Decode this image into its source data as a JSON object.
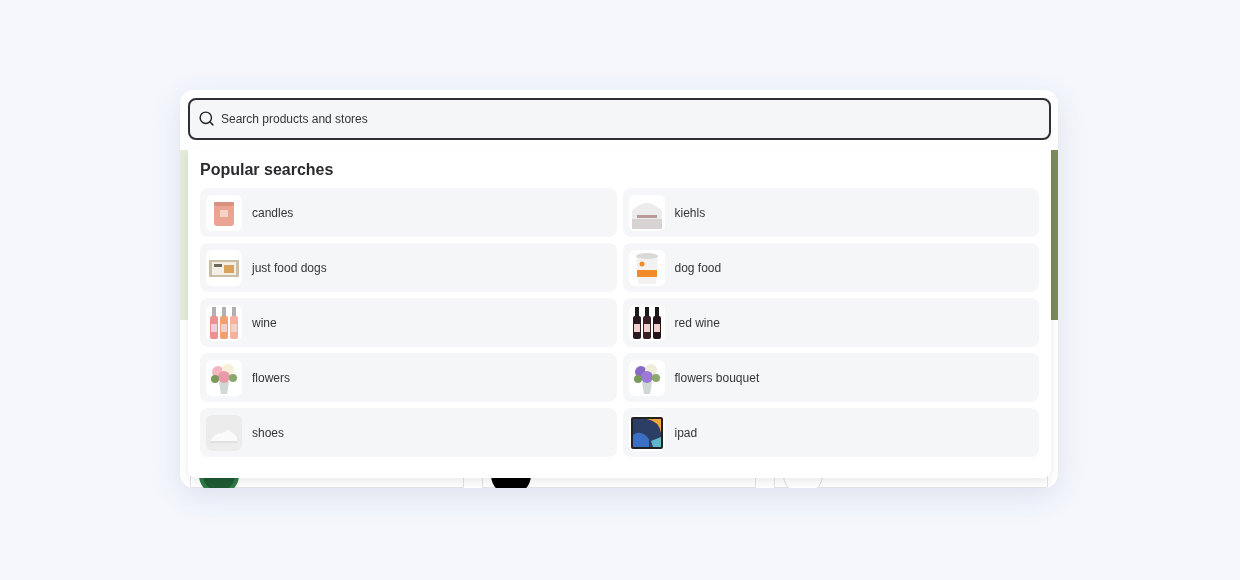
{
  "search": {
    "placeholder": "Search products and stores"
  },
  "popular": {
    "title": "Popular searches",
    "items": [
      {
        "label": "candles",
        "kind": "picture"
      },
      {
        "label": "kiehls",
        "kind": "picture"
      },
      {
        "label": "just food dogs",
        "kind": "picture"
      },
      {
        "label": "dog food",
        "kind": "picture"
      },
      {
        "label": "wine",
        "kind": "picture"
      },
      {
        "label": "red wine",
        "kind": "picture"
      },
      {
        "label": "flowers",
        "kind": "picture"
      },
      {
        "label": "flowers bouquet",
        "kind": "picture"
      },
      {
        "label": "shoes",
        "kind": "picture"
      },
      {
        "label": "ipad",
        "kind": "picture"
      }
    ]
  }
}
